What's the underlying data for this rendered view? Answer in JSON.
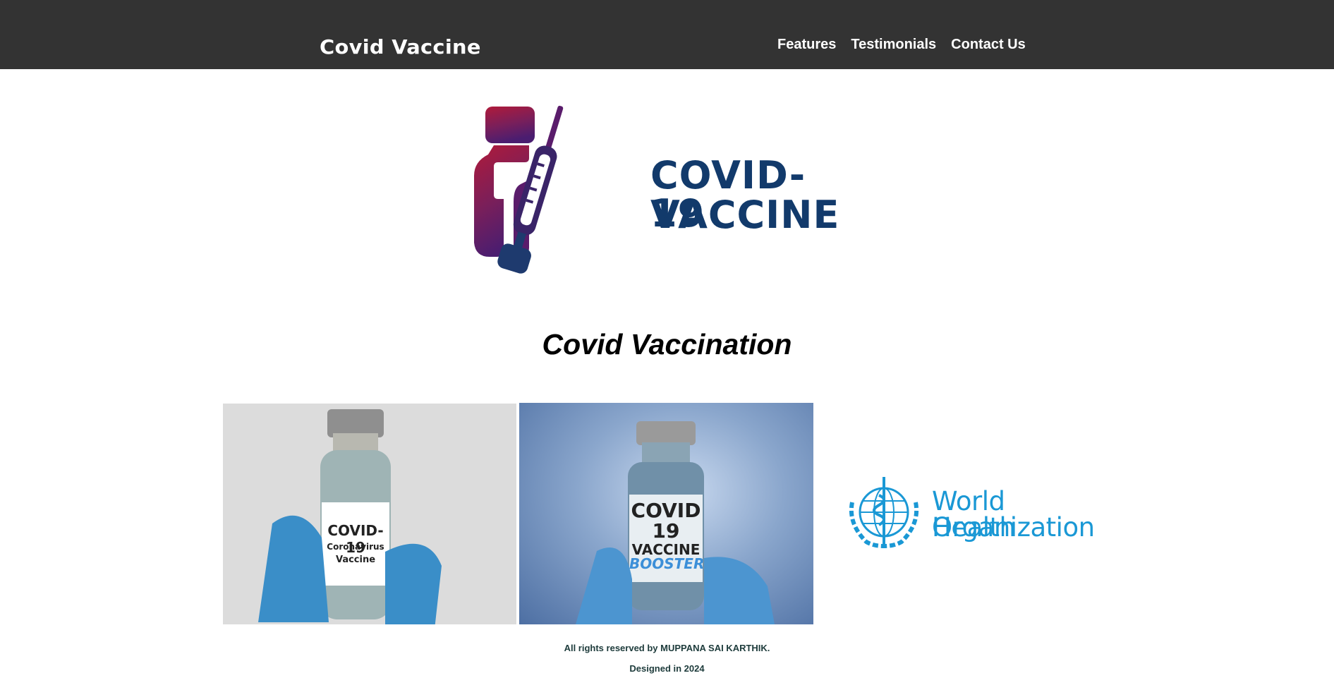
{
  "nav": {
    "brand": "Covid Vaccine",
    "links": [
      "Features",
      "Testimonials",
      "Contact Us"
    ]
  },
  "hero_logo": {
    "line1": "COVID-19",
    "line2": "VACCINE",
    "colors": {
      "text": "#123a6b",
      "vial_top": "#b01a3a",
      "vial_body": "#5a1c6b",
      "syringe": "#1e3a6e"
    }
  },
  "main": {
    "title": "Covid Vaccination"
  },
  "gallery": {
    "photo1": {
      "line1": "COVID-19",
      "line2": "Coronavirus",
      "line3": "Vaccine"
    },
    "photo2": {
      "line1": "COVID",
      "line2": "19",
      "line3": "VACCINE",
      "line4": "BOOSTER"
    },
    "who": {
      "line1": "World Health",
      "line2": "Organization"
    }
  },
  "footer": {
    "rights": "All rights reserved by MUPPANA SAI KARTHIK.",
    "designed": "Designed in 2024"
  },
  "colors": {
    "navbar_bg": "#333333",
    "nav_text": "#ffffff",
    "who_blue": "#1a98d5",
    "footer_text": "#1d3b3b"
  }
}
